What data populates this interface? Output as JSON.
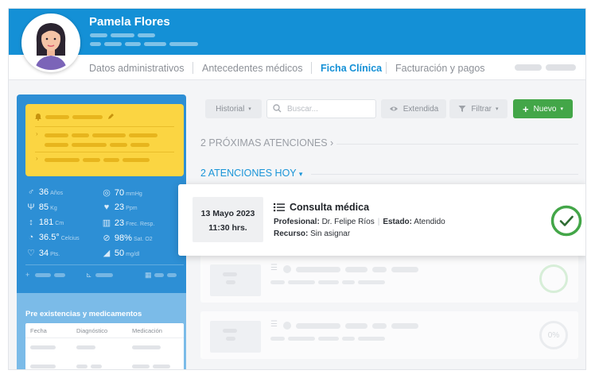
{
  "patient": {
    "name": "Pamela Flores"
  },
  "tabs": [
    {
      "label": "Datos administrativos",
      "active": false
    },
    {
      "label": "Antecedentes médicos",
      "active": false
    },
    {
      "label": "Ficha Clínica",
      "active": true
    },
    {
      "label": "Facturación y pagos",
      "active": false
    }
  ],
  "vitals": [
    {
      "icon": "gender-icon",
      "value": "36",
      "unit": "Años"
    },
    {
      "icon": "blood-pressure-icon",
      "value": "70",
      "unit": "mmHg"
    },
    {
      "icon": "weight-icon",
      "value": "85",
      "unit": "Kg"
    },
    {
      "icon": "heart-icon",
      "value": "23",
      "unit": "Ppm"
    },
    {
      "icon": "height-icon",
      "value": "181",
      "unit": "Cm"
    },
    {
      "icon": "respiration-icon",
      "value": "23",
      "unit": "Frec. Resp."
    },
    {
      "icon": "temperature-icon",
      "value": "36.5°",
      "unit": "Celcius"
    },
    {
      "icon": "saturation-icon",
      "value": "98%",
      "unit": "Sat. O2"
    },
    {
      "icon": "pulse-icon",
      "value": "34",
      "unit": "Pts."
    },
    {
      "icon": "glucose-icon",
      "value": "50",
      "unit": "mg/dl"
    }
  ],
  "preexisting": {
    "title": "Pre existencias y medicamentos",
    "columns": [
      "Fecha",
      "Diagnóstico",
      "Medicación"
    ]
  },
  "toolbar": {
    "historial": "Historial",
    "search_placeholder": "Buscar...",
    "extendida": "Extendida",
    "filtrar": "Filtrar",
    "nuevo": "Nuevo"
  },
  "sections": {
    "upcoming": "2 PRÓXIMAS ATENCIONES",
    "today": "2 ATENCIONES HOY"
  },
  "appointment": {
    "date": "13 Mayo 2023",
    "time": "11:30 hrs.",
    "title": "Consulta médica",
    "professional_label": "Profesional:",
    "professional": "Dr. Felipe Ríos",
    "status_label": "Estado:",
    "status": "Atendido",
    "resource_label": "Recurso:",
    "resource": "Sin asignar"
  },
  "ghost_progress": "0%",
  "colors": {
    "primary": "#1490d6",
    "success": "#43a648",
    "alert": "#fbd542"
  }
}
